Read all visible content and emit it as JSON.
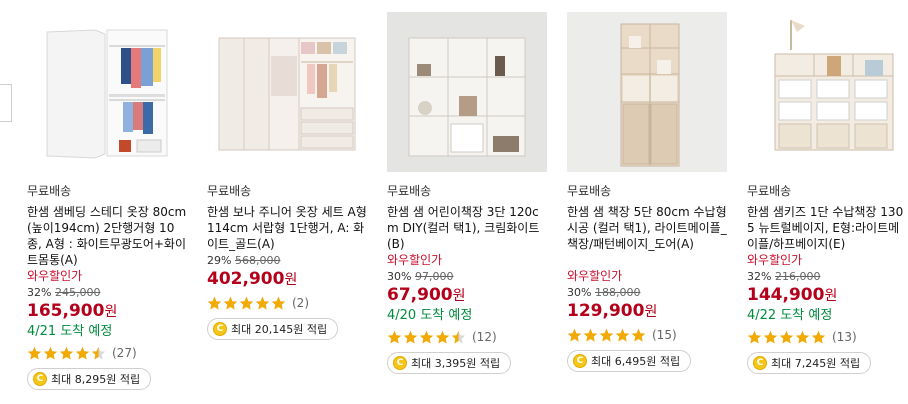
{
  "products": [
    {
      "shipping": "무료배송",
      "title": "한샘 샘베딩 스테디 옷장 80cm(높이194cm) 2단행거형 10종, A형 : 화이트무광도어+화이트몸통(A)",
      "badge": "와우할인가",
      "discount": "32%",
      "original_price": "245,000",
      "price": "165,900",
      "price_unit": "원",
      "arrival": "4/21 도착 예정",
      "rating": 4.5,
      "review_count": "(27)",
      "points": "최대 8,295원 적립",
      "image_icon": "wardrobe-white-icon"
    },
    {
      "shipping": "무료배송",
      "title": "한샘 보나 주니어 옷장 세트 A형 114cm 서랍형 1단행거, A: 화이트_골드(A)",
      "badge": "",
      "discount": "29%",
      "original_price": "568,000",
      "price": "402,900",
      "price_unit": "원",
      "arrival": "",
      "rating": 5,
      "review_count": "(2)",
      "points": "최대 20,145원 적립",
      "image_icon": "wardrobe-set-icon"
    },
    {
      "shipping": "무료배송",
      "title": "한샘 샘 어린이책장 3단 120cm DIY(컬러 택1), 크림화이트(B)",
      "badge": "와우할인가",
      "discount": "30%",
      "original_price": "97,000",
      "price": "67,900",
      "price_unit": "원",
      "arrival": "4/20 도착 예정",
      "rating": 4.5,
      "review_count": "(12)",
      "points": "최대 3,395원 적립",
      "image_icon": "cube-bookshelf-icon"
    },
    {
      "shipping": "무료배송",
      "title": "한샘 샘 책장 5단 80cm 수납형 시공 (컬러 택1), 라이트메이플_책장/패턴베이지_도어(A)",
      "badge": "와우할인가",
      "discount": "30%",
      "original_price": "188,000",
      "price": "129,900",
      "price_unit": "원",
      "arrival": "",
      "rating": 5,
      "review_count": "(15)",
      "points": "최대 6,495원 적립",
      "image_icon": "tall-bookshelf-icon"
    },
    {
      "shipping": "무료배송",
      "title": "한샘 샘키즈 1단 수납책장 1305 뉴트럴베이지, E형:라이트메이플/하프베이지(E)",
      "badge": "와우할인가",
      "discount": "32%",
      "original_price": "216,000",
      "price": "144,900",
      "price_unit": "원",
      "arrival": "4/22 도착 예정",
      "rating": 5,
      "review_count": "(13)",
      "points": "최대 7,245원 적립",
      "image_icon": "storage-shelf-icon"
    }
  ],
  "colors": {
    "price": "#b5001b",
    "badge": "#c8102e",
    "arrival": "#008c3c",
    "star": "#f2a900",
    "coin": "#f5c518"
  }
}
